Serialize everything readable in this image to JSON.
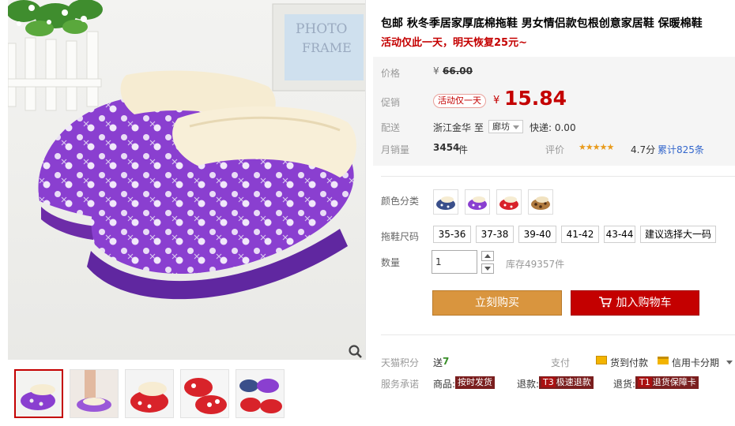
{
  "product": {
    "title": "包邮 秋冬季居家厚底棉拖鞋 男女情侣款包根创意家居鞋 保暖棉鞋",
    "subtitle": "活动仅此一天，明天恢复25元~"
  },
  "gallery": {
    "photo_frame_text_1": "PHOTO",
    "photo_frame_text_2": "FRAME"
  },
  "price": {
    "label": "价格",
    "currency": "¥",
    "original": "66.00"
  },
  "promo": {
    "label": "促销",
    "tag": "活动仅一天",
    "currency": "¥",
    "price": "15.84"
  },
  "shipping": {
    "label": "配送",
    "from": "浙江金华",
    "to_word": "至",
    "destination": "廊坊",
    "fee": "快递: 0.00"
  },
  "sales": {
    "label": "月销量",
    "count": "3454",
    "unit": "件"
  },
  "rating": {
    "label": "评价",
    "stars": "★★★★★",
    "score": "4.7分",
    "total": "累计825条"
  },
  "colors": {
    "label": "颜色分类",
    "swatches": [
      "navy",
      "purple",
      "red",
      "leopard"
    ],
    "palette": {
      "navy": "#3a4f8a",
      "purple": "#8a3fd0",
      "red": "#d8232a",
      "leopard": "#6b4a2b"
    }
  },
  "sizes": {
    "label": "拖鞋尺码",
    "options": [
      "35-36",
      "37-38",
      "39-40",
      "41-42",
      "43-44",
      "建议选择大一码"
    ]
  },
  "quantity": {
    "label": "数量",
    "value": "1",
    "stock": "库存49357件"
  },
  "actions": {
    "buy_now": "立刻购买",
    "add_cart": "加入购物车"
  },
  "points": {
    "label": "天猫积分",
    "prefix": "送",
    "amount": "7"
  },
  "payment": {
    "label": "支付",
    "cod": "货到付款",
    "installment": "信用卡分期"
  },
  "service": {
    "label": "服务承诺",
    "goods_label": "商品:",
    "goods_badge": "按时发货",
    "refund_label": "退款:",
    "refund_num": "T3",
    "refund_badge": "极速退款",
    "return_label": "退货:",
    "return_num": "T1",
    "return_badge": "退货保障卡"
  },
  "theme": {
    "accent_red": "#c40000",
    "buy_orange": "#d9953e",
    "slipper_purple": "#8a3fd0"
  }
}
